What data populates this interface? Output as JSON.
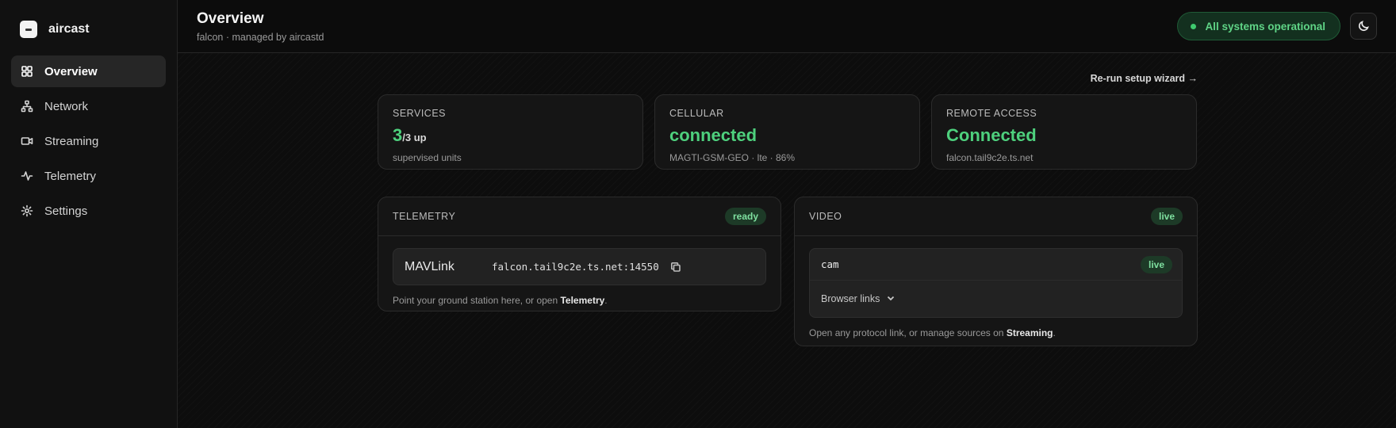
{
  "app": {
    "name": "aircast"
  },
  "sidebar": {
    "items": [
      {
        "label": "Overview",
        "icon": "grid-icon",
        "active": true
      },
      {
        "label": "Network",
        "icon": "network-icon"
      },
      {
        "label": "Streaming",
        "icon": "video-icon"
      },
      {
        "label": "Telemetry",
        "icon": "activity-icon"
      },
      {
        "label": "Settings",
        "icon": "gear-icon"
      }
    ]
  },
  "header": {
    "title": "Overview",
    "subtitle": "falcon · managed by aircastd",
    "status": "All systems operational",
    "theme_icon": "moon-icon"
  },
  "wizard_link": "Re-run setup wizard →",
  "stats": {
    "services": {
      "label": "SERVICES",
      "value": "3",
      "unit": "/3 up",
      "detail": "supervised units"
    },
    "cellular": {
      "label": "CELLULAR",
      "value": "connected",
      "detail": "MAGTI-GSM-GEO · lte · 86%"
    },
    "remote": {
      "label": "REMOTE ACCESS",
      "value": "Connected",
      "detail": "falcon.tail9c2e.ts.net"
    }
  },
  "telemetry": {
    "title": "TELEMETRY",
    "badge": "ready",
    "protocol": "MAVLink",
    "address": "falcon.tail9c2e.ts.net:14550",
    "hint_prefix": "Point your ground station here, or open ",
    "hint_link": "Telemetry",
    "hint_suffix": "."
  },
  "video": {
    "title": "VIDEO",
    "badge": "live",
    "source_name": "cam",
    "source_badge": "live",
    "browser_links": "Browser links",
    "hint_prefix": "Open any protocol link, or manage sources on ",
    "hint_link": "Streaming",
    "hint_suffix": "."
  },
  "colors": {
    "accent_green": "#4ed07d",
    "background": "#0b0b0b",
    "card": "#151515"
  }
}
